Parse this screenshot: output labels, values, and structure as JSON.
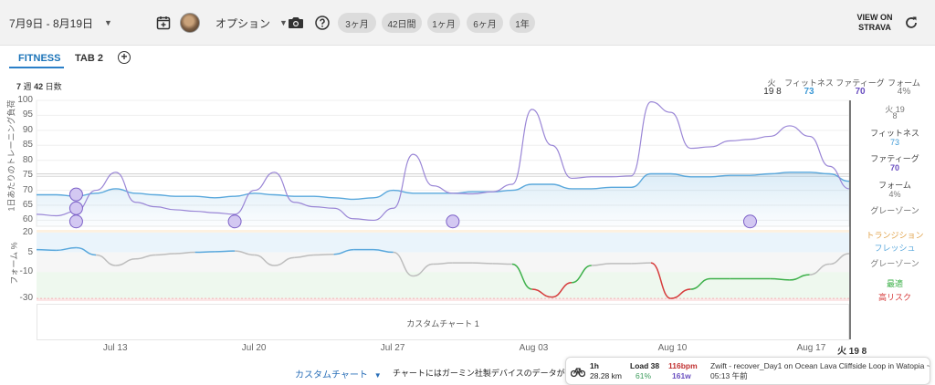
{
  "toolbar": {
    "date_range": "7月9日 - 8月19日",
    "options_label": "オプション",
    "range_buttons": [
      "3ヶ月",
      "42日間",
      "1ヶ月",
      "6ヶ月",
      "1年"
    ],
    "view_on": "VIEW ON",
    "strava": "STRAVA"
  },
  "tabs": [
    {
      "label": "FITNESS",
      "active": true
    },
    {
      "label": "TAB 2",
      "active": false
    }
  ],
  "period": {
    "weeks": "7",
    "weeks_unit": "週",
    "days": "42",
    "days_unit": "日数"
  },
  "header_metrics": {
    "day_label": "火",
    "day_value": "19 8",
    "fitness_label": "フィットネス",
    "fitness_value": "73",
    "fatigue_label": "ファティーグ",
    "fatigue_value": "70",
    "form_label": "フォーム",
    "form_value": "4%"
  },
  "side_legend": {
    "day": "火 19",
    "day2": "8",
    "fitness_label": "フィットネス",
    "fitness_value": "73",
    "fatigue_label": "ファティーグ",
    "fatigue_value": "70",
    "form_label": "フォーム",
    "form_value": "4%",
    "grey_zone": "グレーゾーン",
    "transition": "トランジション",
    "fresh": "フレッシュ",
    "grey_zone2": "グレーゾーン",
    "optimal": "最適",
    "high_risk": "高リスク"
  },
  "chart_data": [
    {
      "type": "line",
      "ylabel": "1日あたりのトレーニング負荷",
      "yticks": [
        60,
        65,
        70,
        75,
        80,
        85,
        90,
        95,
        100
      ],
      "ylim": [
        58,
        100
      ],
      "x_dates": [
        "Jul 09",
        "Jul 10",
        "Jul 11",
        "Jul 12",
        "Jul 13",
        "Jul 14",
        "Jul 15",
        "Jul 16",
        "Jul 17",
        "Jul 18",
        "Jul 19",
        "Jul 20",
        "Jul 21",
        "Jul 22",
        "Jul 23",
        "Jul 24",
        "Jul 25",
        "Jul 26",
        "Jul 27",
        "Jul 28",
        "Jul 29",
        "Jul 30",
        "Jul 31",
        "Aug 01",
        "Aug 02",
        "Aug 03",
        "Aug 04",
        "Aug 05",
        "Aug 06",
        "Aug 07",
        "Aug 08",
        "Aug 09",
        "Aug 10",
        "Aug 11",
        "Aug 12",
        "Aug 13",
        "Aug 14",
        "Aug 15",
        "Aug 16",
        "Aug 17",
        "Aug 18",
        "Aug 19"
      ],
      "series": [
        {
          "name": "フィットネス",
          "color": "#5aa8dc",
          "values": [
            68.5,
            68.5,
            68,
            69,
            70.5,
            69,
            68.5,
            68,
            68,
            67.5,
            68,
            69,
            68.5,
            68,
            68,
            67.5,
            67,
            67.5,
            70,
            69,
            69,
            69,
            69.5,
            69.5,
            70,
            72,
            72,
            70.5,
            70.5,
            71,
            71,
            75.5,
            75.5,
            74.5,
            74.5,
            75,
            75,
            75.5,
            76,
            76,
            75.5,
            73
          ]
        },
        {
          "name": "ファティーグ",
          "color": "#9a86d6",
          "values": [
            62,
            61.5,
            63,
            70,
            76,
            66,
            64.5,
            63.5,
            63,
            62.5,
            62,
            70,
            76,
            66,
            64.5,
            64,
            60.5,
            60,
            64,
            82,
            71.5,
            69,
            68.8,
            69.5,
            72,
            97,
            85,
            74,
            74.5,
            74.5,
            74.8,
            99.5,
            96,
            84,
            84.5,
            86.5,
            87,
            88,
            91.5,
            88,
            78,
            70.5
          ]
        }
      ],
      "reference_line": 75
    },
    {
      "type": "line",
      "ylabel": "フォーム %",
      "yticks": [
        20,
        5,
        -10,
        -30
      ],
      "ylim": [
        -32,
        22
      ],
      "zones": [
        "トランジション",
        "フレッシュ",
        "グレーゾーン",
        "最適",
        "高リスク"
      ],
      "series": [
        {
          "name": "フォーム",
          "values": [
            7,
            6.5,
            8.5,
            3,
            -5,
            0,
            3,
            4,
            5,
            5.5,
            6,
            3,
            -5,
            1,
            3,
            3.5,
            7,
            7,
            5,
            -13,
            -4,
            -3,
            -3,
            -3.5,
            -4,
            -23,
            -29,
            -18,
            -5,
            -3.5,
            -3.5,
            -3,
            -30,
            -23,
            -15,
            -15,
            -15,
            -15,
            -16,
            -12,
            -4,
            4
          ]
        }
      ],
      "x_ticks": [
        "Jul 13",
        "Jul 20",
        "Jul 27",
        "Aug 03",
        "Aug 10",
        "Aug 17"
      ],
      "x_end_label": "火 19 8"
    }
  ],
  "custom_chart_label": "カスタムチャート 1",
  "footer": {
    "custom_chart_button": "カスタムチャート",
    "note": "チャートにはガーミン社製デバイスのデータが含ま"
  },
  "activity_popup": {
    "duration": "1h",
    "distance": "28.28 km",
    "load_label": "Load 38",
    "load_pct": "61%",
    "hr": "116bpm",
    "watts": "161w",
    "title": "Zwift - recover_Day1 on Ocean Lava Cliffside Loop in Watopia ~",
    "time": "05:13 午前"
  },
  "colors": {
    "fitness": "#5aa8dc",
    "fatigue": "#7b5fc7",
    "form_grey": "#bdbdbd",
    "form_green": "#3db04a",
    "form_red": "#d63b3b",
    "accent": "#2a7fc8"
  }
}
